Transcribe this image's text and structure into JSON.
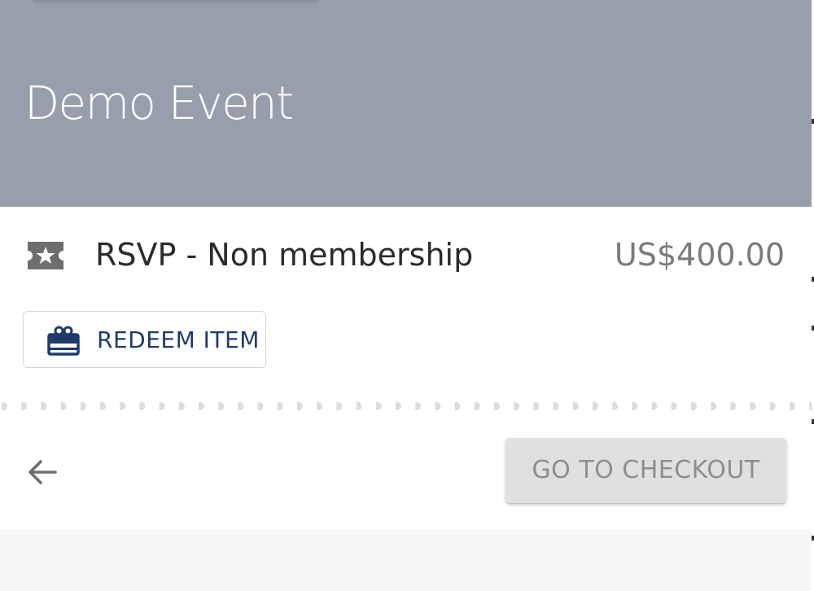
{
  "event": {
    "title": "Demo Event"
  },
  "ticket": {
    "name": "RSVP - Non membership",
    "price": "US$400.00",
    "icon": "ticket-star-icon"
  },
  "redeem": {
    "label": "REDEEM ITEM",
    "icon": "gift-card-icon"
  },
  "actions": {
    "back_icon": "arrow-left-icon",
    "checkout_label": "GO TO CHECKOUT"
  },
  "colors": {
    "header_bg": "#989fac",
    "redeem_accent": "#1f3a6b",
    "checkout_disabled_bg": "#e0e0e0",
    "checkout_disabled_text": "#8e8e8e",
    "icon_gray": "#6e6e6e"
  }
}
